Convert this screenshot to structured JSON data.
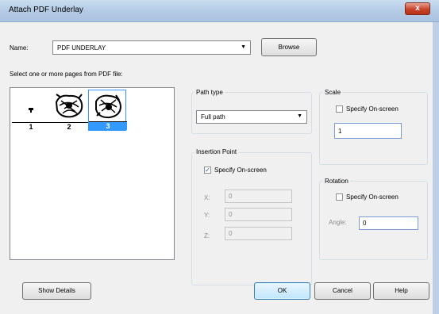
{
  "window": {
    "title": "Attach PDF Underlay",
    "close_glyph": "x"
  },
  "name_row": {
    "label": "Name:",
    "value": "PDF UNDERLAY",
    "browse_label": "Browse"
  },
  "pages": {
    "prompt": "Select one or more pages from PDF file:",
    "items": [
      {
        "number": "1",
        "selected": false
      },
      {
        "number": "2",
        "selected": false
      },
      {
        "number": "3",
        "selected": true
      }
    ]
  },
  "path_type": {
    "title": "Path type",
    "value": "Full path"
  },
  "insertion_point": {
    "title": "Insertion Point",
    "specify_label": "Specify On-screen",
    "specify_checked": true,
    "x_label": "X:",
    "x_value": "0",
    "y_label": "Y:",
    "y_value": "0",
    "z_label": "Z:",
    "z_value": "0"
  },
  "scale": {
    "title": "Scale",
    "specify_label": "Specify On-screen",
    "specify_checked": false,
    "value": "1"
  },
  "rotation": {
    "title": "Rotation",
    "specify_label": "Specify On-screen",
    "specify_checked": false,
    "angle_label": "Angle:",
    "angle_value": "0"
  },
  "buttons": {
    "show_details": "Show Details",
    "ok": "OK",
    "cancel": "Cancel",
    "help": "Help"
  },
  "colors": {
    "selection": "#3399ff",
    "titlebar": "#b7cde6",
    "close": "#c8432b"
  }
}
